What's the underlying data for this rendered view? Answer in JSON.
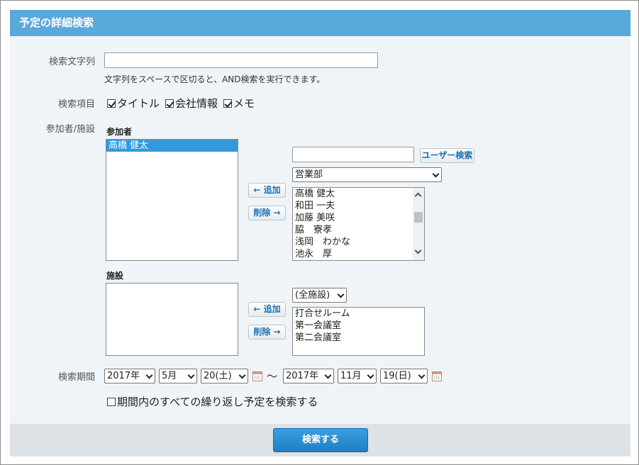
{
  "header": {
    "title": "予定の詳細検索"
  },
  "keyword": {
    "label": "検索文字列",
    "value": "",
    "hint": "文字列をスペースで区切ると、AND検索を実行できます。"
  },
  "search_items": {
    "label": "検索項目",
    "options": [
      {
        "label": "タイトル",
        "checked": true
      },
      {
        "label": "会社情報",
        "checked": true
      },
      {
        "label": "メモ",
        "checked": true
      }
    ]
  },
  "participants_facilities": {
    "label": "参加者/施設",
    "participants": {
      "label": "参加者",
      "selected": [
        "高橋 健太"
      ],
      "add_label": "← 追加",
      "remove_label": "削除 →",
      "user_search_value": "",
      "user_search_button": "ユーザー検索",
      "department": "営業部",
      "candidates": [
        "高橋 健太",
        "和田 一夫",
        "加藤 美咲",
        "脇　寮孝",
        "浅岡　わかな",
        "池永　厚"
      ]
    },
    "facilities": {
      "label": "施設",
      "selected": [],
      "add_label": "← 追加",
      "remove_label": "削除 →",
      "group": "(全施設)",
      "candidates": [
        "打合せルーム",
        "第一会議室",
        "第二会議室"
      ]
    }
  },
  "period": {
    "label": "検索期間",
    "start": {
      "year": "2017年",
      "month": "5月",
      "day": "20(土)"
    },
    "separator": "～",
    "end": {
      "year": "2017年",
      "month": "11月",
      "day": "19(日)"
    },
    "repeat_option": {
      "label": "期間内のすべての繰り返し予定を検索する",
      "checked": false
    }
  },
  "footer": {
    "search_button": "検索する"
  }
}
